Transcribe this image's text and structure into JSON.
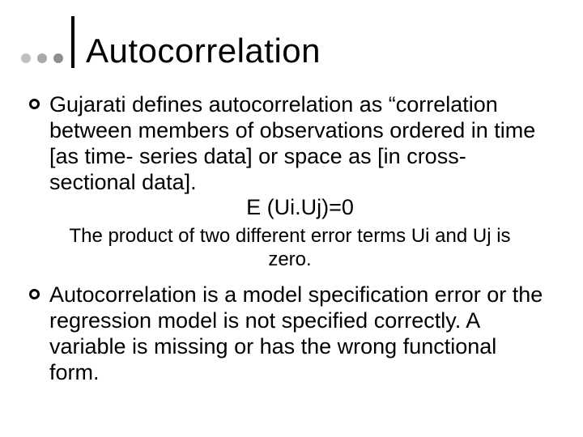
{
  "dot_colors": [
    "#c0c0c0",
    "#a9a9a9",
    "#8f8f8f"
  ],
  "title": "Autocorrelation",
  "bullets": [
    {
      "text": "Gujarati defines autocorrelation as “correlation between members of observations ordered in time [as time- series data] or space as [in cross-sectional data].",
      "equation": "E (Ui.Uj)=0"
    }
  ],
  "subnote": "The product of two different error terms Ui and Uj is zero.",
  "bullets2": [
    {
      "text": "Autocorrelation is a model specification error or the regression model is not specified correctly. A variable is missing or has the wrong functional form."
    }
  ]
}
